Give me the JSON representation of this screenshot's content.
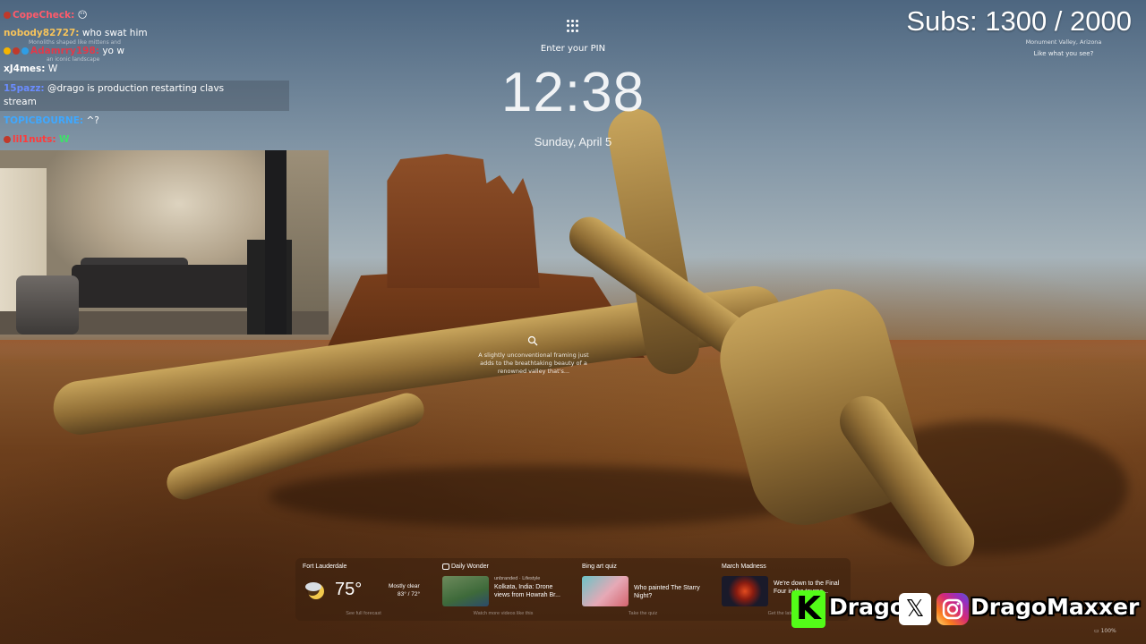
{
  "stream": {
    "subs_label": "Subs: 1300 / 2000"
  },
  "lockscreen": {
    "pin_prompt": "Enter your PIN",
    "time": "12:38",
    "date": "Sunday, April 5",
    "location": "Monument Valley, Arizona",
    "like_prompt": "Like what you see?",
    "spotlight_caption": "A slightly unconventional framing just adds to the breathtaking beauty of a renowned valley that's..."
  },
  "chat": {
    "messages": [
      {
        "user": "CopeCheck:",
        "text": "😶",
        "color": "#ff5b6b"
      },
      {
        "user": "nobody82727:",
        "text": "who swat him",
        "color": "#f6c35b"
      },
      {
        "user": "Adamrry198:",
        "text": "yo w",
        "color": "#e03a4a"
      },
      {
        "user": "xJ4mes:",
        "text": "W",
        "color": "#ffffff"
      },
      {
        "user": "15pazz:",
        "text": "@drago is production restarting clavs",
        "text2": "stream",
        "color": "#6a8cff"
      },
      {
        "user": "TOPICBOURNE:",
        "text": "^?",
        "color": "#3fa8ff"
      },
      {
        "user": "lil1nuts:",
        "text": "W",
        "color": "#ff3b3b"
      }
    ],
    "ghost_1": "Monoliths shaped like mittens and",
    "ghost_2": "an iconic landscape"
  },
  "widgets": [
    {
      "title": "Fort Lauderdale",
      "temp": "75°",
      "condition": "Mostly clear",
      "range": "83° / 72°",
      "footer": "See full forecast"
    },
    {
      "title": "Daily Wonder",
      "source": "unbranded · Lifestyle",
      "headline": "Kolkata, India: Drone views from Howrah Br...",
      "footer": "Watch more videos like this"
    },
    {
      "title": "Bing art quiz",
      "headline": "Who painted The Starry Night?",
      "footer": "Take the quiz"
    },
    {
      "title": "March Madness",
      "headline": "We're down to the Final Four in the tourna...",
      "footer": "Get the latest"
    }
  ],
  "social": {
    "kick_letter": "K",
    "kick_name": "Drago",
    "x_letter": "𝕏",
    "instagram_name": "DragoMaxxer"
  },
  "tray": {
    "battery": "100%"
  },
  "colors": {
    "kick_green": "#53fc18",
    "chat_highlight": "#3c4650"
  }
}
